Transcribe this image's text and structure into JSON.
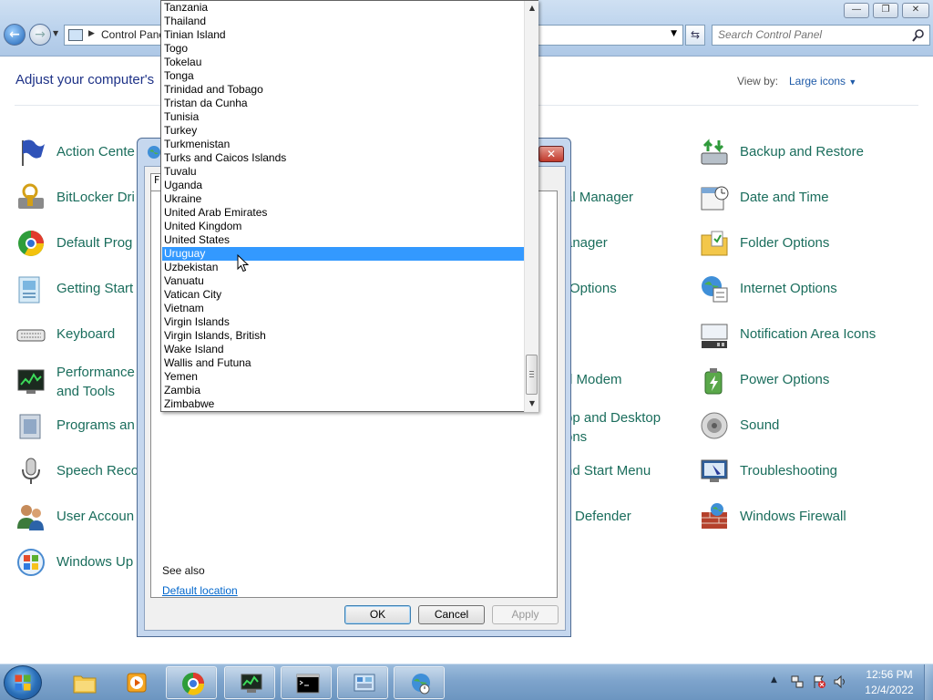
{
  "window": {
    "address_path": "Control Panel",
    "search_placeholder": "Search Control Panel",
    "header": "Adjust your computer's",
    "view_by_label": "View by:",
    "view_by_value": "Large icons"
  },
  "control_panel_items": [
    {
      "label": "Action Cente",
      "icon": "action-center-flag-icon"
    },
    {
      "label": "BitLocker Dri",
      "icon": "bitlocker-icon"
    },
    {
      "label": "Default Prog",
      "icon": "default-programs-icon"
    },
    {
      "label": "Getting Start",
      "icon": "getting-started-icon"
    },
    {
      "label": "Keyboard",
      "icon": "keyboard-icon"
    },
    {
      "label": "Performance",
      "label2": "and Tools",
      "icon": "performance-icon"
    },
    {
      "label": "Programs an",
      "icon": "programs-icon"
    },
    {
      "label": "Speech Reco",
      "icon": "microphone-icon"
    },
    {
      "label": "User Accoun",
      "icon": "user-accounts-icon"
    },
    {
      "label": "Windows Up",
      "icon": "windows-update-icon"
    },
    {
      "label": "al Manager"
    },
    {
      "label": "anager"
    },
    {
      "label": "Options"
    },
    {
      "label": "d Modem"
    },
    {
      "label": "pp and Desktop",
      "label2": "ons"
    },
    {
      "label": "nd Start Menu"
    },
    {
      "label": "Defender"
    },
    {
      "label": "Backup and Restore",
      "icon": "backup-restore-icon"
    },
    {
      "label": "Date and Time",
      "icon": "date-time-icon"
    },
    {
      "label": "Folder Options",
      "icon": "folder-options-icon"
    },
    {
      "label": "Internet Options",
      "icon": "internet-options-icon"
    },
    {
      "label": "Notification Area Icons",
      "icon": "notification-area-icon"
    },
    {
      "label": "Power Options",
      "icon": "power-options-icon"
    },
    {
      "label": "Sound",
      "icon": "speaker-icon"
    },
    {
      "label": "Troubleshooting",
      "icon": "troubleshooting-icon"
    },
    {
      "label": "Windows Firewall",
      "icon": "firewall-icon"
    }
  ],
  "dialog": {
    "tab_label": "F",
    "see_also": "See also",
    "default_location": "Default location",
    "ok": "OK",
    "cancel": "Cancel",
    "apply": "Apply"
  },
  "dropdown": {
    "selected": "Uruguay",
    "options": [
      "Tanzania",
      "Thailand",
      "Tinian Island",
      "Togo",
      "Tokelau",
      "Tonga",
      "Trinidad and Tobago",
      "Tristan da Cunha",
      "Tunisia",
      "Turkey",
      "Turkmenistan",
      "Turks and Caicos Islands",
      "Tuvalu",
      "Uganda",
      "Ukraine",
      "United Arab Emirates",
      "United Kingdom",
      "United States",
      "Uruguay",
      "Uzbekistan",
      "Vanuatu",
      "Vatican City",
      "Vietnam",
      "Virgin Islands",
      "Virgin Islands, British",
      "Wake Island",
      "Wallis and Futuna",
      "Yemen",
      "Zambia",
      "Zimbabwe"
    ]
  },
  "taskbar": {
    "items": [
      "windows-explorer-icon",
      "media-player-icon",
      "chrome-icon",
      "system-monitor-icon",
      "command-prompt-icon",
      "control-panel-icon",
      "region-globe-icon"
    ],
    "time": "12:56 PM",
    "date": "12/4/2022"
  }
}
